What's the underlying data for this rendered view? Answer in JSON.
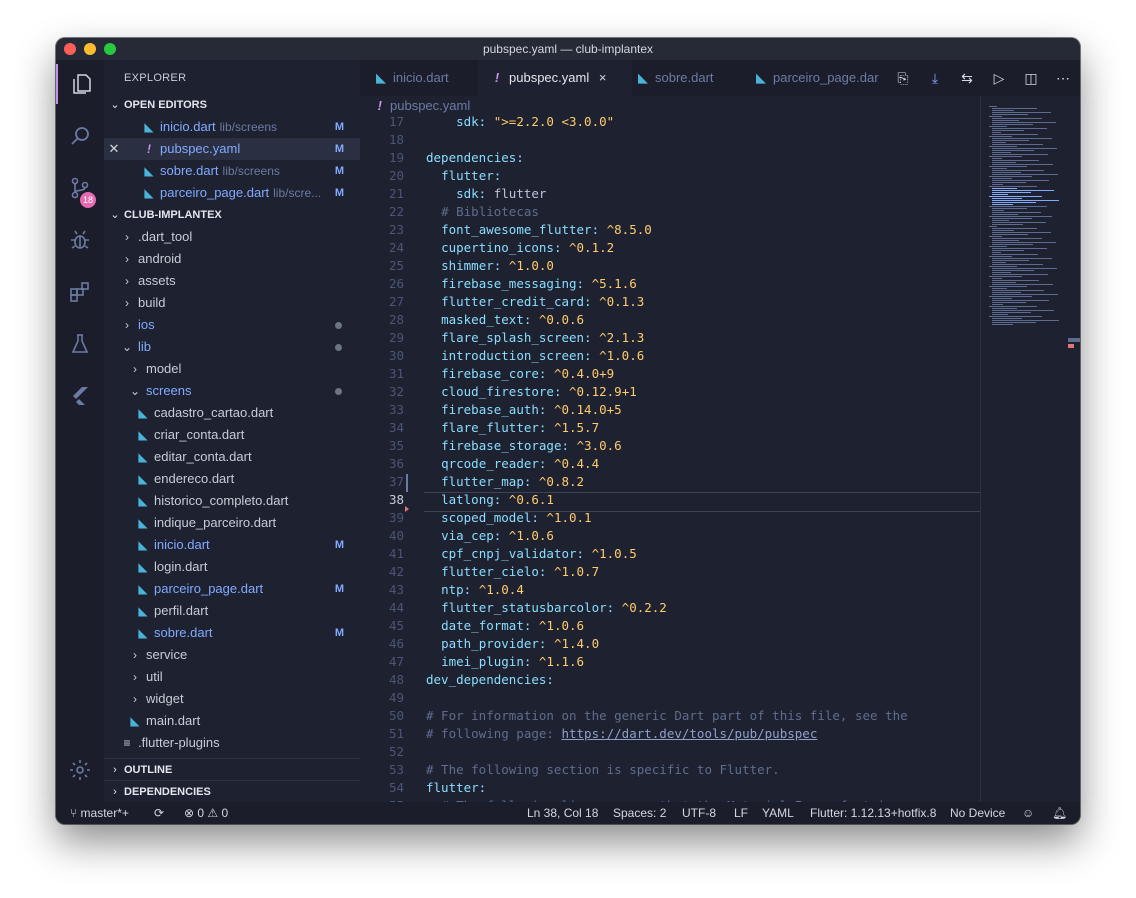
{
  "window": {
    "title": "pubspec.yaml — club-implantex"
  },
  "activity_bar": {
    "scm_badge": "18"
  },
  "sidebar": {
    "title": "EXPLORER",
    "open_editors_label": "OPEN EDITORS",
    "open_editors": [
      {
        "name": "inicio.dart",
        "path": "lib/screens",
        "flag": "M"
      },
      {
        "name": "pubspec.yaml",
        "path": "",
        "flag": "M"
      },
      {
        "name": "sobre.dart",
        "path": "lib/screens",
        "flag": "M"
      },
      {
        "name": "parceiro_page.dart",
        "path": "lib/scre...",
        "flag": "M"
      }
    ],
    "project_label": "CLUB-IMPLANTEX",
    "tree": [
      {
        "name": ".dart_tool"
      },
      {
        "name": "android"
      },
      {
        "name": "assets"
      },
      {
        "name": "build"
      },
      {
        "name": "ios"
      },
      {
        "name": "lib"
      },
      {
        "name": "model"
      },
      {
        "name": "screens"
      },
      {
        "name": "cadastro_cartao.dart"
      },
      {
        "name": "criar_conta.dart"
      },
      {
        "name": "editar_conta.dart"
      },
      {
        "name": "endereco.dart"
      },
      {
        "name": "historico_completo.dart"
      },
      {
        "name": "indique_parceiro.dart"
      },
      {
        "name": "inicio.dart",
        "flag": "M"
      },
      {
        "name": "login.dart"
      },
      {
        "name": "parceiro_page.dart",
        "flag": "M"
      },
      {
        "name": "perfil.dart"
      },
      {
        "name": "sobre.dart",
        "flag": "M"
      },
      {
        "name": "service"
      },
      {
        "name": "util"
      },
      {
        "name": "widget"
      },
      {
        "name": "main.dart"
      },
      {
        "name": ".flutter-plugins"
      }
    ],
    "outline_label": "OUTLINE",
    "dependencies_label": "DEPENDENCIES"
  },
  "tabs": [
    {
      "label": "inicio.dart"
    },
    {
      "label": "pubspec.yaml",
      "close": "×"
    },
    {
      "label": "sobre.dart"
    },
    {
      "label": "parceiro_page.dar"
    }
  ],
  "breadcrumb": "pubspec.yaml",
  "editor": {
    "lines": [
      {
        "n": "17",
        "indent": "    ",
        "key": "sdk:",
        "val": " \">=2.2.0 <3.0.0\""
      },
      {
        "n": "18"
      },
      {
        "n": "19",
        "indent": "",
        "key": "dependencies:"
      },
      {
        "n": "20",
        "indent": "  ",
        "key": "flutter:"
      },
      {
        "n": "21",
        "indent": "    ",
        "key": "sdk:",
        "plain": " flutter"
      },
      {
        "n": "22",
        "indent": "  ",
        "comment": "# Bibliotecas"
      },
      {
        "n": "23",
        "indent": "  ",
        "key": "font_awesome_flutter:",
        "val": " ^8.5.0"
      },
      {
        "n": "24",
        "indent": "  ",
        "key": "cupertino_icons:",
        "val": " ^0.1.2"
      },
      {
        "n": "25",
        "indent": "  ",
        "key": "shimmer:",
        "val": " ^1.0.0"
      },
      {
        "n": "26",
        "indent": "  ",
        "key": "firebase_messaging:",
        "val": " ^5.1.6"
      },
      {
        "n": "27",
        "indent": "  ",
        "key": "flutter_credit_card:",
        "val": " ^0.1.3"
      },
      {
        "n": "28",
        "indent": "  ",
        "key": "masked_text:",
        "val": " ^0.0.6"
      },
      {
        "n": "29",
        "indent": "  ",
        "key": "flare_splash_screen:",
        "val": " ^2.1.3"
      },
      {
        "n": "30",
        "indent": "  ",
        "key": "introduction_screen:",
        "val": " ^1.0.6"
      },
      {
        "n": "31",
        "indent": "  ",
        "key": "firebase_core:",
        "val": " ^0.4.0+9"
      },
      {
        "n": "32",
        "indent": "  ",
        "key": "cloud_firestore:",
        "val": " ^0.12.9+1"
      },
      {
        "n": "33",
        "indent": "  ",
        "key": "firebase_auth:",
        "val": " ^0.14.0+5"
      },
      {
        "n": "34",
        "indent": "  ",
        "key": "flare_flutter:",
        "val": " ^1.5.7"
      },
      {
        "n": "35",
        "indent": "  ",
        "key": "firebase_storage:",
        "val": " ^3.0.6"
      },
      {
        "n": "36",
        "indent": "  ",
        "key": "qrcode_reader:",
        "val": " ^0.4.4"
      },
      {
        "n": "37",
        "indent": "  ",
        "key": "flutter_map:",
        "val": " ^0.8.2"
      },
      {
        "n": "38",
        "indent": "  ",
        "key": "latlong:",
        "val": " ^0.6.1"
      },
      {
        "n": "39",
        "indent": "  ",
        "key": "scoped_model:",
        "val": " ^1.0.1"
      },
      {
        "n": "40",
        "indent": "  ",
        "key": "via_cep:",
        "val": " ^1.0.6"
      },
      {
        "n": "41",
        "indent": "  ",
        "key": "cpf_cnpj_validator:",
        "val": " ^1.0.5"
      },
      {
        "n": "42",
        "indent": "  ",
        "key": "flutter_cielo:",
        "val": " ^1.0.7"
      },
      {
        "n": "43",
        "indent": "  ",
        "key": "ntp:",
        "val": " ^1.0.4"
      },
      {
        "n": "44",
        "indent": "  ",
        "key": "flutter_statusbarcolor:",
        "val": " ^0.2.2"
      },
      {
        "n": "45",
        "indent": "  ",
        "key": "date_format:",
        "val": " ^1.0.6"
      },
      {
        "n": "46",
        "indent": "  ",
        "key": "path_provider:",
        "val": " ^1.4.0"
      },
      {
        "n": "47",
        "indent": "  ",
        "key": "imei_plugin:",
        "val": " ^1.1.6"
      },
      {
        "n": "48",
        "indent": "",
        "key": "dev_dependencies:"
      },
      {
        "n": "49"
      },
      {
        "n": "50",
        "indent": "",
        "comment": "# For information on the generic Dart part of this file, see the"
      },
      {
        "n": "51",
        "indent": "",
        "comment": "# following page: ",
        "link": "https://dart.dev/tools/pub/pubspec"
      },
      {
        "n": "52"
      },
      {
        "n": "53",
        "indent": "",
        "comment": "# The following section is specific to Flutter."
      },
      {
        "n": "54",
        "indent": "",
        "key": "flutter:"
      },
      {
        "n": "55",
        "indent": "  ",
        "comment": "# The following line ensures that the Material Icons font is"
      }
    ],
    "current_line": "38"
  },
  "statusbar": {
    "branch": "master*+",
    "errors": "0",
    "warnings": "0",
    "position": "Ln 38, Col 18",
    "spaces": "Spaces: 2",
    "encoding": "UTF-8",
    "eol": "LF",
    "language": "YAML",
    "flutter": "Flutter: 1.12.13+hotfix.8",
    "device": "No Device"
  }
}
